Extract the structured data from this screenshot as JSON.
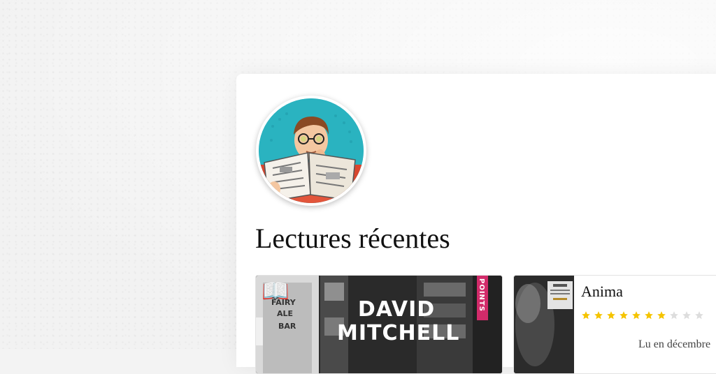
{
  "profile": {
    "avatar_icon": "reading-man-avatar-icon"
  },
  "section": {
    "title": "Lectures récentes"
  },
  "books": [
    {
      "emoji": "📖",
      "emoji_icon": "open-book-icon",
      "cover_author_first": "DAVID",
      "cover_author_last": "MITCHELL",
      "cover_publisher": "POINTS"
    },
    {
      "title": "Anima",
      "rating": 7,
      "rating_max": 10,
      "read_date": "Lu en décembre"
    }
  ],
  "colors": {
    "star_filled": "#f5c400",
    "star_empty": "#dddddd",
    "publisher_band": "#d22b6a",
    "avatar_bg": "#2ab3c0"
  }
}
